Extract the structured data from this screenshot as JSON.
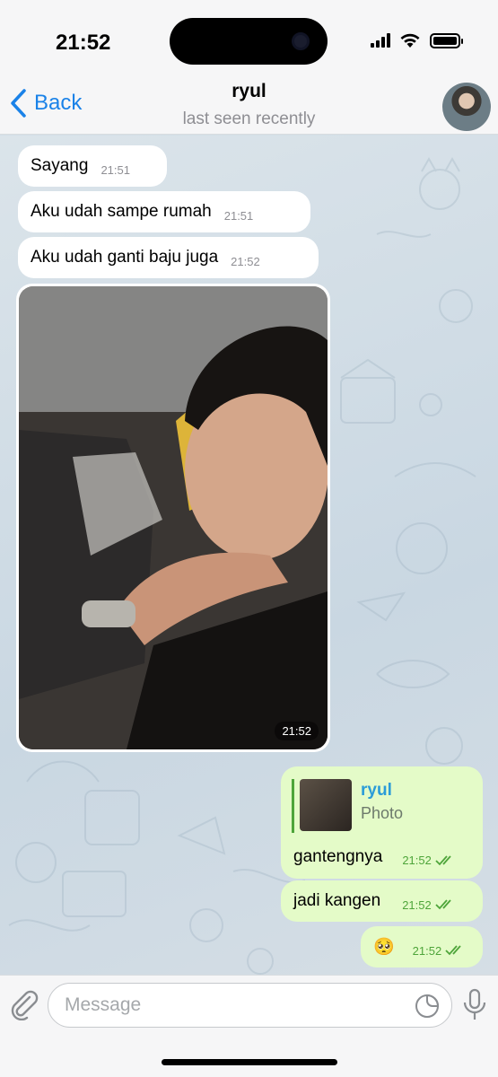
{
  "status_bar": {
    "time": "21:52"
  },
  "header": {
    "back_label": "Back",
    "contact_name": "ryul",
    "last_seen": "last seen recently"
  },
  "messages": [
    {
      "text": "Sayang",
      "time": "21:51",
      "direction": "incoming"
    },
    {
      "text": "Aku udah sampe rumah",
      "time": "21:51",
      "direction": "incoming"
    },
    {
      "text": "Aku udah ganti baju juga",
      "time": "21:52",
      "direction": "incoming"
    }
  ],
  "photo_message": {
    "time": "21:52",
    "direction": "incoming"
  },
  "reply_message": {
    "quote_name": "ryul",
    "quote_type": "Photo",
    "text": "gantengnya",
    "time": "21:52",
    "direction": "outgoing"
  },
  "outgoing": [
    {
      "text": "jadi kangen",
      "time": "21:52"
    },
    {
      "text": "🥺",
      "time": "21:52"
    }
  ],
  "composer": {
    "placeholder": "Message"
  },
  "colors": {
    "accent": "#1a82e8",
    "outgoing_bubble": "#e4fbc8",
    "incoming_bubble": "#ffffff",
    "read_checks": "#4ea53a"
  }
}
